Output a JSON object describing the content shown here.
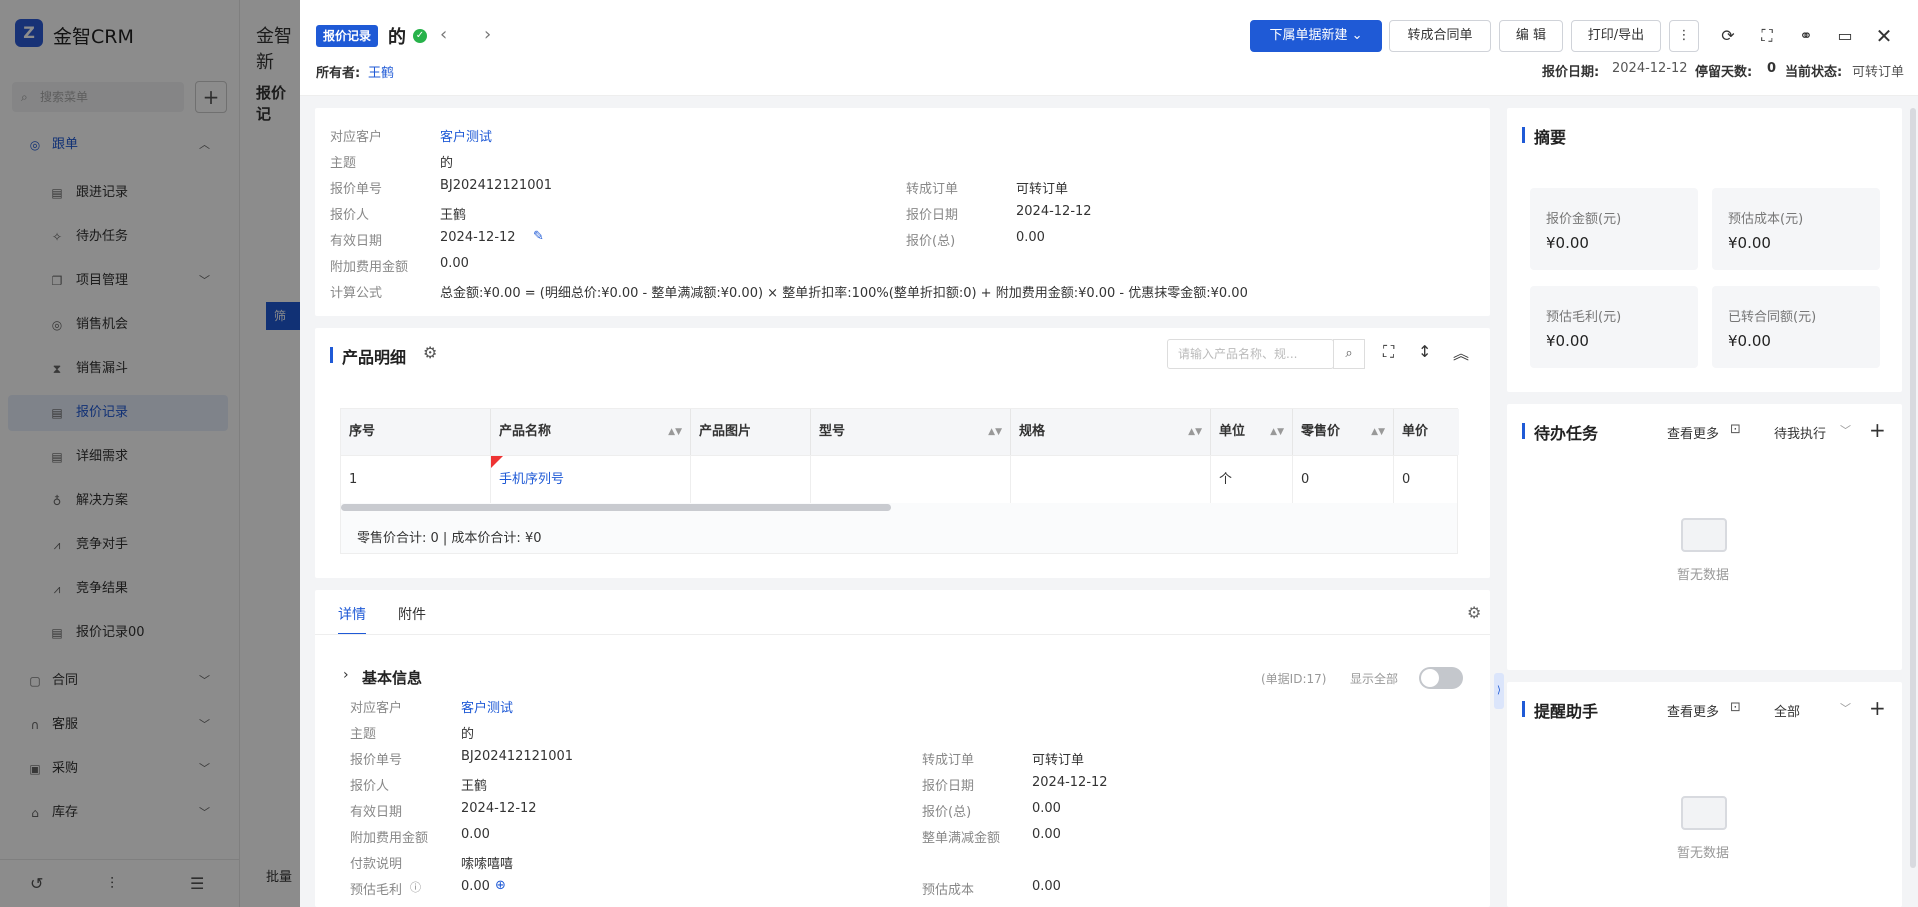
{
  "app": {
    "logo_glyph": "Z",
    "name": "金智CRM",
    "search_placeholder": "搜索菜单",
    "menu": [
      {
        "label": "跟单",
        "icon": "follow-icon"
      },
      {
        "label": "跟进记录"
      },
      {
        "label": "待办任务"
      },
      {
        "label": "项目管理"
      },
      {
        "label": "销售机会"
      },
      {
        "label": "销售漏斗"
      },
      {
        "label": "报价记录"
      },
      {
        "label": "详细需求"
      },
      {
        "label": "解决方案"
      },
      {
        "label": "竞争对手"
      },
      {
        "label": "竞争结果"
      },
      {
        "label": "报价记录00"
      },
      {
        "label": "合同"
      },
      {
        "label": "客服"
      },
      {
        "label": "采购"
      },
      {
        "label": "库存"
      }
    ],
    "bg_title": "金智新",
    "bg_sub": "报价记",
    "bg_filter": "筛",
    "bg_batch": "批量"
  },
  "header": {
    "tag": "报价记录",
    "title": "的",
    "owner_label": "所有者:",
    "owner": "王鹤",
    "buttons": {
      "create_sub": "下属单据新建",
      "to_contract": "转成合同单",
      "edit": "编 辑",
      "print": "打印/导出"
    },
    "quote_date_label": "报价日期:",
    "quote_date": "2024-12-12",
    "stay_days_label": "停留天数:",
    "stay_days": "0",
    "status_label": "当前状态:",
    "status": "可转订单"
  },
  "info": {
    "customer_label": "对应客户",
    "customer": "客户测试",
    "subject_label": "主题",
    "subject": "的",
    "no_label": "报价单号",
    "no": "BJ202412121001",
    "quoter_label": "报价人",
    "quoter": "王鹤",
    "valid_label": "有效日期",
    "valid": "2024-12-12",
    "extra_label": "附加费用金额",
    "extra": "0.00",
    "formula_label": "计算公式",
    "formula": "总金额:¥0.00 = (明细总价:¥0.00 - 整单满减额:¥0.00) × 整单折扣率:100%(整单折扣额:0) + 附加费用金额:¥0.00 - 优惠抹零金额:¥0.00",
    "order_label": "转成订单",
    "order": "可转订单",
    "date_label": "报价日期",
    "date": "2024-12-12",
    "total_label": "报价(总)",
    "total": "0.00"
  },
  "products": {
    "title": "产品明细",
    "search_placeholder": "请输入产品名称、规...",
    "columns": [
      "序号",
      "产品名称",
      "产品图片",
      "型号",
      "规格",
      "单位",
      "零售价",
      "单价"
    ],
    "rows": [
      [
        "1",
        "手机序列号",
        "",
        "",
        "",
        "个",
        "0",
        "0"
      ]
    ],
    "footer": "零售价合计: 0 |   成本价合计: ¥0"
  },
  "detail": {
    "tabs": [
      "详情",
      "附件"
    ],
    "section_title": "基本信息",
    "doc_id": "(单据ID:17)",
    "show_all": "显示全部",
    "customer_label": "对应客户",
    "customer": "客户测试",
    "subject_label": "主题",
    "subject": "的",
    "no_label": "报价单号",
    "no": "BJ202412121001",
    "quoter_label": "报价人",
    "quoter": "王鹤",
    "valid_label": "有效日期",
    "valid": "2024-12-12",
    "extra_label": "附加费用金额",
    "extra": "0.00",
    "pay_label": "付款说明",
    "pay": "嗦嗦嘻嘻",
    "profit_label": "预估毛利",
    "profit": "0.00",
    "order_label": "转成订单",
    "order": "可转订单",
    "date_label": "报价日期",
    "date": "2024-12-12",
    "total_label": "报价(总)",
    "total": "0.00",
    "discount_label": "整单满减金额",
    "discount": "0.00",
    "cost_label": "预估成本",
    "cost": "0.00"
  },
  "summary": {
    "title": "摘要",
    "cards": [
      {
        "label": "报价金额(元)",
        "value": "¥0.00"
      },
      {
        "label": "预估成本(元)",
        "value": "¥0.00"
      },
      {
        "label": "预估毛利(元)",
        "value": "¥0.00"
      },
      {
        "label": "已转合同额(元)",
        "value": "¥0.00"
      }
    ]
  },
  "todo": {
    "title": "待办任务",
    "more": "查看更多",
    "filter": "待我执行",
    "empty": "暂无数据"
  },
  "reminder": {
    "title": "提醒助手",
    "more": "查看更多",
    "filter": "全部",
    "empty": "暂无数据"
  }
}
